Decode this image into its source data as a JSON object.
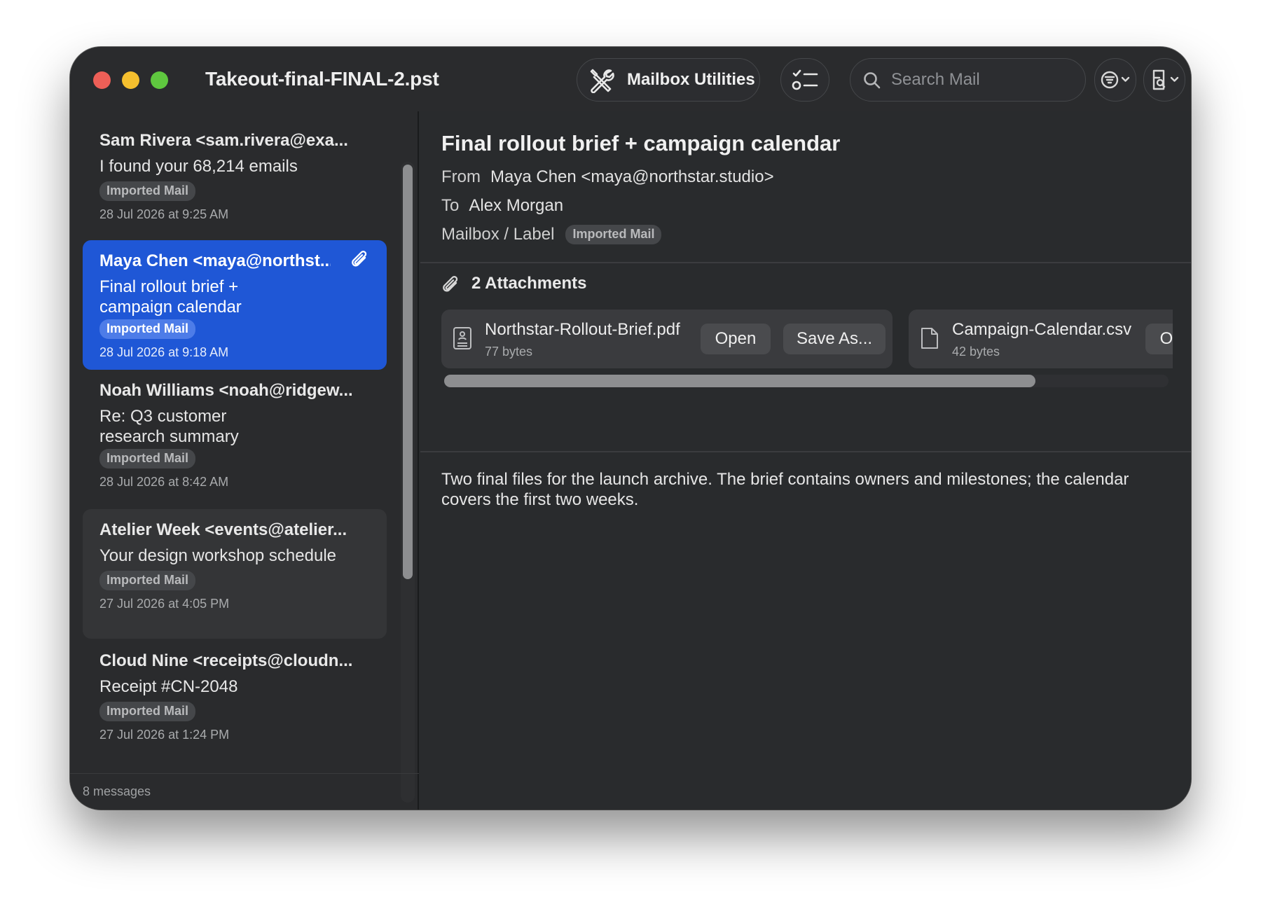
{
  "window": {
    "title": "Takeout-final-FINAL-2.pst"
  },
  "toolbar": {
    "utilities_label": "Mailbox Utilities",
    "utilities_icon": "wrench-screwdriver-icon",
    "tasks_icon": "checklist-icon",
    "search_placeholder": "Search Mail",
    "filter_icon": "filter-icon",
    "view_icon": "view-options-icon"
  },
  "messages": [
    {
      "sender": "Sam Rivera <sam.rivera@exa...",
      "subject": "I found your 68,214 emails",
      "mailbox": "Imported Mail",
      "date": "28 Jul 2026 at 9:25 AM"
    },
    {
      "sender": "Maya Chen <maya@northst...",
      "subject": "Final rollout brief + campaign calendar",
      "mailbox": "Imported Mail",
      "date": "28 Jul 2026 at 9:18 AM",
      "has_attachment": true,
      "selected": true
    },
    {
      "sender": "Noah Williams <noah@ridgew...",
      "subject": "Re: Q3 customer research summary",
      "mailbox": "Imported Mail",
      "date": "28 Jul 2026 at 8:42 AM"
    },
    {
      "sender": "Atelier Week <events@atelier...",
      "subject": "Your design workshop schedule",
      "mailbox": "Imported Mail",
      "date": "27 Jul 2026 at 4:05 PM",
      "hovered": true
    },
    {
      "sender": "Cloud Nine <receipts@cloudn...",
      "subject": "Receipt #CN-2048",
      "mailbox": "Imported Mail",
      "date": "27 Jul 2026 at 1:24 PM"
    }
  ],
  "status": {
    "message_count": "8 messages"
  },
  "reader": {
    "subject": "Final rollout brief + campaign calendar",
    "from_label": "From",
    "from": "Maya Chen <maya@northstar.studio>",
    "to_label": "To",
    "to": "Alex Morgan",
    "mailbox_label": "Mailbox / Label",
    "mailbox": "Imported Mail",
    "attachments_heading": "2 Attachments",
    "attachments": [
      {
        "name": "Northstar-Rollout-Brief.pdf",
        "size": "77 bytes",
        "icon": "pdf-document-icon",
        "open_label": "Open",
        "save_label": "Save As..."
      },
      {
        "name": "Campaign-Calendar.csv",
        "size": "42 bytes",
        "icon": "generic-document-icon",
        "open_label": "Open"
      }
    ],
    "body": "Two final files for the launch archive. The brief contains owners and milestones; the calendar covers the first two weeks."
  },
  "colors": {
    "accent": "#1f57d6",
    "window_bg": "#292b2d",
    "close": "#ed5f57",
    "minimize": "#f5bf2e",
    "zoom": "#5fc73f"
  }
}
